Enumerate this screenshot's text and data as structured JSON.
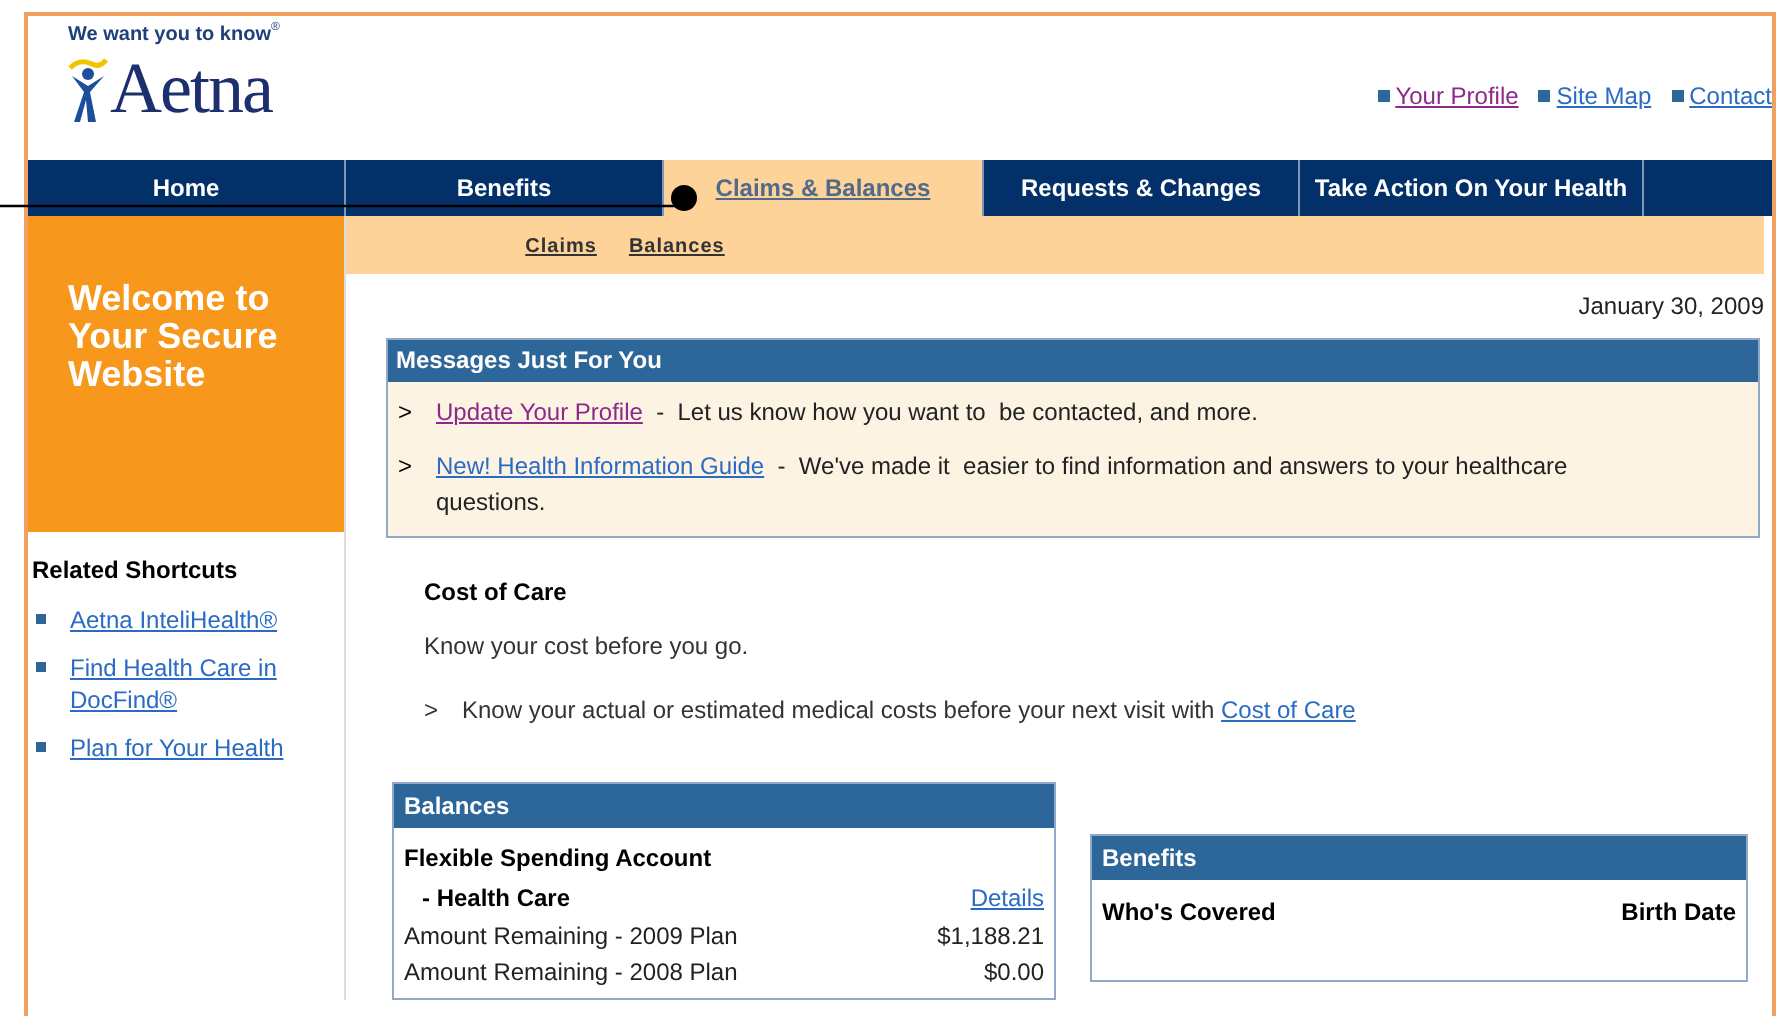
{
  "header": {
    "tagline": "We want you to know",
    "tagline_mark": "®",
    "wordmark": "Aetna",
    "top_links": [
      {
        "label": "Your Profile",
        "visited": true
      },
      {
        "label": "Site Map",
        "visited": false
      },
      {
        "label": "Contact",
        "visited": false
      }
    ]
  },
  "nav": [
    {
      "label": "Home",
      "selected": false
    },
    {
      "label": "Benefits",
      "selected": false
    },
    {
      "label": "Claims & Balances",
      "selected": true
    },
    {
      "label": "Requests & Changes",
      "selected": false
    },
    {
      "label": "Take Action On Your Health",
      "selected": false
    }
  ],
  "subnav": [
    "Claims",
    "Balances"
  ],
  "sidebar": {
    "welcome": "Welcome to Your Secure Website",
    "shortcuts_title": "Related Shortcuts",
    "shortcuts": [
      "Aetna InteliHealth®",
      "Find Health Care in DocFind®",
      "Plan for Your Health"
    ]
  },
  "date": "January 30, 2009",
  "messages": {
    "title": "Messages Just For You",
    "items": [
      {
        "marker": ">",
        "link": "Update Your Profile",
        "visited": true,
        "text": "-  Let us know how you want to  be contacted, and more."
      },
      {
        "marker": ">",
        "link": "New! Health Information Guide",
        "visited": false,
        "text": "-  We've made it  easier to find information and answers to your healthcare questions."
      }
    ]
  },
  "cost_of_care": {
    "title": "Cost of Care",
    "subtitle": "Know your cost before you go.",
    "marker": ">",
    "text": "Know your actual or estimated medical costs before your next visit with",
    "link": "Cost of Care"
  },
  "balances": {
    "title": "Balances",
    "account": "Flexible Spending Account",
    "sub_account": "- Health Care",
    "details_link": "Details",
    "rows": [
      {
        "label": "Amount Remaining - 2009 Plan",
        "value": "$1,188.21"
      },
      {
        "label": "Amount Remaining - 2008 Plan",
        "value": "$0.00"
      }
    ]
  },
  "benefits": {
    "title": "Benefits",
    "columns": [
      "Who's Covered",
      "Birth Date"
    ]
  }
}
